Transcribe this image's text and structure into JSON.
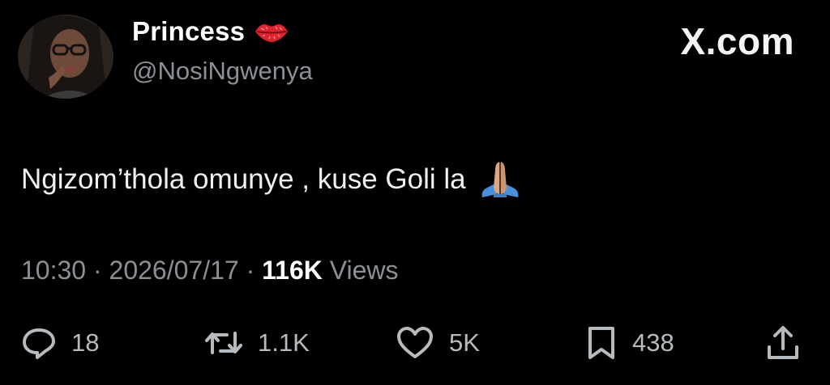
{
  "header": {
    "display_name": "Princess",
    "name_emoji_icon": "kiss-lips-icon",
    "handle": "@NosiNgwenya",
    "site_logo": "X.com"
  },
  "tweet": {
    "text": "Ngizom’thola omunye , kuse Goli la",
    "emoji_icon": "folded-hands-icon"
  },
  "meta": {
    "time": "10:30",
    "separator": "·",
    "date": "2026/07/17",
    "views_count": "116K",
    "views_label": "Views"
  },
  "actions": {
    "replies": {
      "icon": "reply-icon",
      "count": "18"
    },
    "reposts": {
      "icon": "repost-icon",
      "count": "1.1K"
    },
    "likes": {
      "icon": "heart-icon",
      "count": "5K"
    },
    "bookmarks": {
      "icon": "bookmark-icon",
      "count": "438"
    },
    "share": {
      "icon": "share-icon"
    }
  },
  "colors": {
    "background": "#000000",
    "primary_text": "#e7e9ea",
    "secondary_text": "#8b9096",
    "lips_red": "#e0242f"
  }
}
